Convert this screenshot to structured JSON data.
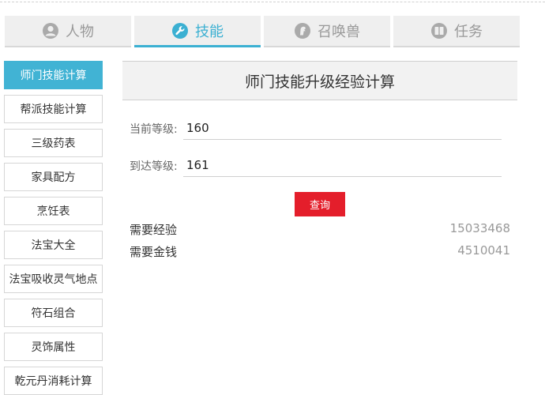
{
  "tabs": [
    {
      "label": "人物",
      "icon": "person-icon"
    },
    {
      "label": "技能",
      "icon": "wrench-icon"
    },
    {
      "label": "召唤兽",
      "icon": "pet-icon"
    },
    {
      "label": "任务",
      "icon": "book-icon"
    }
  ],
  "active_tab": 1,
  "accent_color": "#41b3d4",
  "button_color": "#e41e2b",
  "sidebar": {
    "items": [
      {
        "label": "师门技能计算"
      },
      {
        "label": "帮派技能计算"
      },
      {
        "label": "三级药表"
      },
      {
        "label": "家具配方"
      },
      {
        "label": "烹饪表"
      },
      {
        "label": "法宝大全"
      },
      {
        "label": "法宝吸收灵气地点"
      },
      {
        "label": "符石组合"
      },
      {
        "label": "灵饰属性"
      },
      {
        "label": "乾元丹消耗计算"
      }
    ],
    "active_index": 0
  },
  "panel": {
    "title": "师门技能升级经验计算",
    "current_level_label": "当前等级:",
    "current_level_value": "160",
    "target_level_label": "到达等级:",
    "target_level_value": "161",
    "query_button": "查询",
    "results": [
      {
        "label": "需要经验",
        "value": "15033468"
      },
      {
        "label": "需要金钱",
        "value": "4510041"
      }
    ]
  }
}
